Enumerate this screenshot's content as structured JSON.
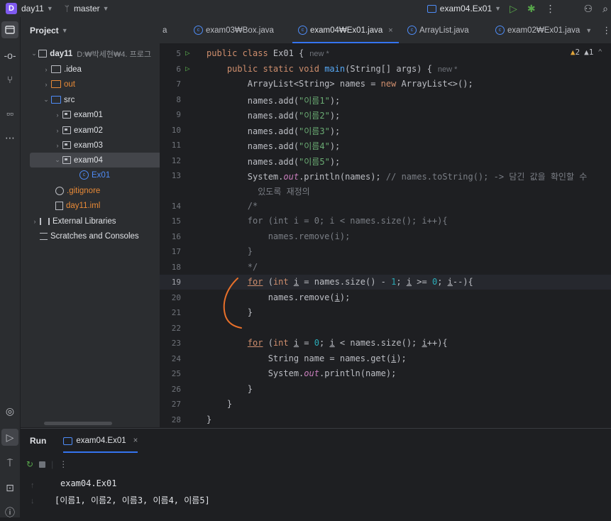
{
  "titlebar": {
    "project_badge": "D",
    "project_name": "day11",
    "branch_icon": "branch-icon",
    "branch": "master",
    "run_config": "exam04.Ex01",
    "icons": [
      "run-icon",
      "debug-icon",
      "more-icon",
      "add-user-icon",
      "search-icon"
    ]
  },
  "toolstrip": {
    "top": [
      "folder-icon",
      "commit-icon",
      "pull-request-icon",
      "structure-icon",
      "more-icon"
    ],
    "bottom": [
      "services-icon",
      "run-icon",
      "build-icon",
      "terminal-icon",
      "problems-icon"
    ]
  },
  "project": {
    "header": "Project",
    "tree": [
      {
        "label": "day11",
        "suffix": "D:₩박세현₩4. 프로그",
        "depth": 0,
        "expanded": true,
        "icon": "folder-icon"
      },
      {
        "label": ".idea",
        "depth": 1,
        "expanded": false,
        "icon": "folder-icon"
      },
      {
        "label": "out",
        "depth": 1,
        "expanded": false,
        "icon": "folder-icon",
        "excluded": true
      },
      {
        "label": "src",
        "depth": 1,
        "expanded": true,
        "icon": "folder-icon"
      },
      {
        "label": "exam01",
        "depth": 2,
        "expanded": false,
        "icon": "package-icon"
      },
      {
        "label": "exam02",
        "depth": 2,
        "expanded": false,
        "icon": "package-icon"
      },
      {
        "label": "exam03",
        "depth": 2,
        "expanded": false,
        "icon": "package-icon"
      },
      {
        "label": "exam04",
        "depth": 2,
        "expanded": true,
        "icon": "package-icon",
        "selected": true
      },
      {
        "label": "Ex01",
        "depth": 3,
        "icon": "class-icon"
      },
      {
        "label": ".gitignore",
        "depth": 1,
        "icon": "ignore-file-icon"
      },
      {
        "label": "day11.iml",
        "depth": 1,
        "icon": "module-file-icon"
      },
      {
        "label": "External Libraries",
        "depth": 0,
        "expanded": false,
        "icon": "library-icon"
      },
      {
        "label": "Scratches and Consoles",
        "depth": 0,
        "icon": "scratch-icon"
      }
    ]
  },
  "tabs": {
    "items": [
      {
        "label": "a",
        "active": false
      },
      {
        "label": "exam03₩Box.java",
        "active": false
      },
      {
        "label": "exam04₩Ex01.java",
        "active": true
      },
      {
        "label": "ArrayList.java",
        "active": false
      },
      {
        "label": "exam02₩Ex01.java",
        "active": false
      }
    ],
    "close": "×"
  },
  "editor": {
    "warnings": "2",
    "weak_warnings": "1",
    "hint_new": "new *",
    "line_numbers": [
      "5",
      "6",
      "7",
      "8",
      "9",
      "10",
      "11",
      "12",
      "13",
      "",
      "14",
      "15",
      "16",
      "17",
      "18",
      "19",
      "20",
      "21",
      "22",
      "23",
      "24",
      "25",
      "26",
      "27",
      "28"
    ],
    "current_line": "19"
  },
  "run_panel": {
    "title": "Run",
    "tab": "exam04.Ex01",
    "close": "×",
    "output": [
      "exam04.Ex01",
      "[이름1, 이름2, 이름3, 이름4, 이름5]"
    ]
  }
}
